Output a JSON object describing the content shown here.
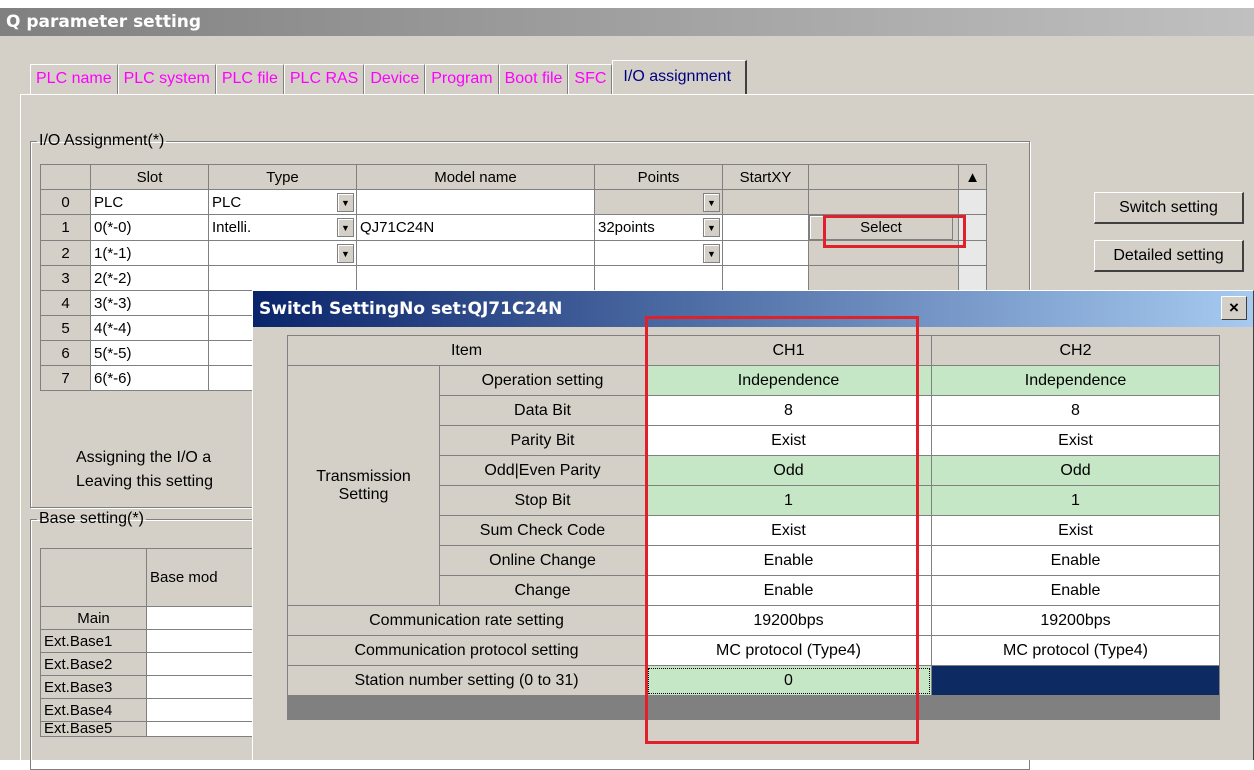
{
  "window": {
    "title": "Q parameter setting"
  },
  "tabs": [
    "PLC name",
    "PLC system",
    "PLC file",
    "PLC RAS",
    "Device",
    "Program",
    "Boot file",
    "SFC",
    "I/O assignment"
  ],
  "io_assignment": {
    "legend": "I/O Assignment(*)",
    "columns": [
      "Slot",
      "Type",
      "Model name",
      "Points",
      "StartXY"
    ],
    "rows": [
      {
        "no": "0",
        "slot": "PLC",
        "type": "PLC",
        "model": "",
        "points": "",
        "start": ""
      },
      {
        "no": "1",
        "slot": "0(*-0)",
        "type": "Intelli.",
        "model": "QJ71C24N",
        "points": "32points",
        "start": ""
      },
      {
        "no": "2",
        "slot": "1(*-1)",
        "type": "",
        "model": "",
        "points": "",
        "start": ""
      },
      {
        "no": "3",
        "slot": "2(*-2)"
      },
      {
        "no": "4",
        "slot": "3(*-3)"
      },
      {
        "no": "5",
        "slot": "4(*-4)"
      },
      {
        "no": "6",
        "slot": "5(*-5)"
      },
      {
        "no": "7",
        "slot": "6(*-6)"
      }
    ],
    "select_label": "Select",
    "note_line1": "Assigning the I/O a",
    "note_line2": "Leaving this setting"
  },
  "buttons": {
    "switch_setting": "Switch setting",
    "detailed_setting": "Detailed setting"
  },
  "base_setting": {
    "legend": "Base setting(*)",
    "col_header": "Base mod",
    "rows": [
      "Main",
      "Ext.Base1",
      "Ext.Base2",
      "Ext.Base3",
      "Ext.Base4",
      "Ext.Base5"
    ]
  },
  "dialog": {
    "title": "Switch SettingNo set:QJ71C24N",
    "close": "×",
    "headers": {
      "item": "Item",
      "ch1": "CH1",
      "ch2": "CH2"
    },
    "group_label_line1": "Transmission",
    "group_label_line2": "Setting",
    "transmission_rows": [
      {
        "label": "Operation setting",
        "ch1": "Independence",
        "ch2": "Independence",
        "color": "green"
      },
      {
        "label": "Data Bit",
        "ch1": "8",
        "ch2": "8",
        "color": "white"
      },
      {
        "label": "Parity Bit",
        "ch1": "Exist",
        "ch2": "Exist",
        "color": "white"
      },
      {
        "label": "Odd|Even Parity",
        "ch1": "Odd",
        "ch2": "Odd",
        "color": "green"
      },
      {
        "label": "Stop Bit",
        "ch1": "1",
        "ch2": "1",
        "color": "green"
      },
      {
        "label": "Sum Check Code",
        "ch1": "Exist",
        "ch2": "Exist",
        "color": "white"
      },
      {
        "label": "Online Change",
        "ch1": "Enable",
        "ch2": "Enable",
        "color": "white"
      },
      {
        "label": "Change",
        "ch1": "Enable",
        "ch2": "Enable",
        "color": "white"
      }
    ],
    "rate_label": "Communication rate setting",
    "rate_ch1": "19200bps",
    "rate_ch2": "19200bps",
    "protocol_label": "Communication protocol setting",
    "protocol_ch1": "MC protocol (Type4)",
    "protocol_ch2": "MC protocol (Type4)",
    "station_label": "Station number setting (0 to 31)",
    "station_ch1": "0"
  },
  "colors": {
    "highlight": "#e0202a",
    "tab_text": "#ff00ff",
    "green_cell": "#c6e7c6",
    "selected_cell": "#0d2a63"
  }
}
